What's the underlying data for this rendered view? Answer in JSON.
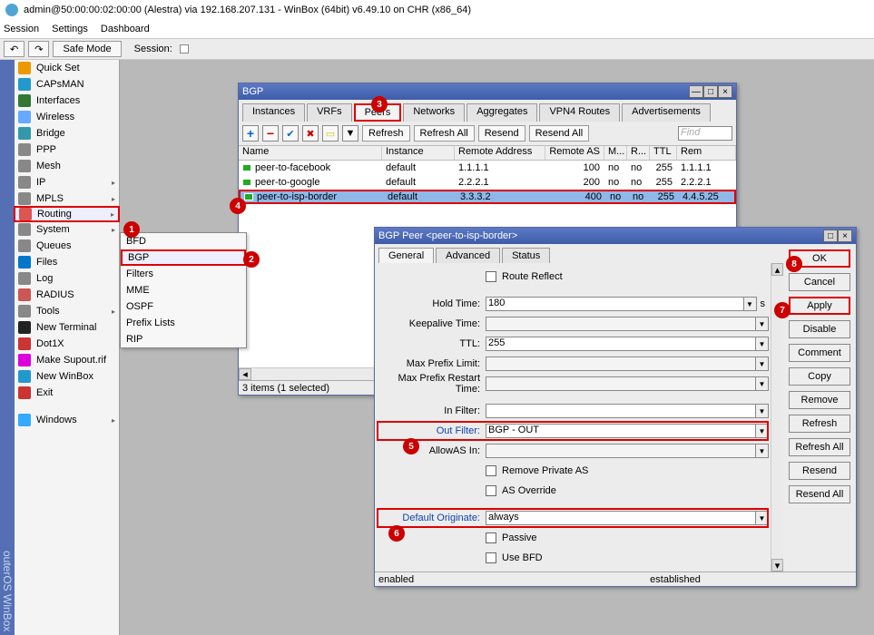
{
  "title": "admin@50:00:00:02:00:00 (Alestra) via 192.168.207.131 - WinBox (64bit) v6.49.10 on CHR (x86_64)",
  "menubar": [
    "Session",
    "Settings",
    "Dashboard"
  ],
  "topstrip": {
    "safe_mode": "Safe Mode",
    "session_label": "Session:"
  },
  "side_label": "outerOS WinBox",
  "sidebar": [
    {
      "label": "Quick Set",
      "tri": false
    },
    {
      "label": "CAPsMAN",
      "tri": false
    },
    {
      "label": "Interfaces",
      "tri": false
    },
    {
      "label": "Wireless",
      "tri": false
    },
    {
      "label": "Bridge",
      "tri": false
    },
    {
      "label": "PPP",
      "tri": false
    },
    {
      "label": "Mesh",
      "tri": false
    },
    {
      "label": "IP",
      "tri": true
    },
    {
      "label": "MPLS",
      "tri": true
    },
    {
      "label": "Routing",
      "tri": true,
      "selected": true
    },
    {
      "label": "System",
      "tri": true
    },
    {
      "label": "Queues",
      "tri": false
    },
    {
      "label": "Files",
      "tri": false
    },
    {
      "label": "Log",
      "tri": false
    },
    {
      "label": "RADIUS",
      "tri": false
    },
    {
      "label": "Tools",
      "tri": true
    },
    {
      "label": "New Terminal",
      "tri": false
    },
    {
      "label": "Dot1X",
      "tri": false
    },
    {
      "label": "Make Supout.rif",
      "tri": false
    },
    {
      "label": "New WinBox",
      "tri": false
    },
    {
      "label": "Exit",
      "tri": false
    }
  ],
  "sidebar_windows": {
    "label": "Windows",
    "tri": true
  },
  "submenu": [
    {
      "label": "BFD"
    },
    {
      "label": "BGP",
      "selected": true
    },
    {
      "label": "Filters"
    },
    {
      "label": "MME"
    },
    {
      "label": "OSPF"
    },
    {
      "label": "Prefix Lists"
    },
    {
      "label": "RIP"
    }
  ],
  "bgp_window": {
    "title": "BGP",
    "tabs": [
      "Instances",
      "VRFs",
      "Peers",
      "Networks",
      "Aggregates",
      "VPN4 Routes",
      "Advertisements"
    ],
    "active_tab": "Peers",
    "buttons": {
      "refresh": "Refresh",
      "refresh_all": "Refresh All",
      "resend": "Resend",
      "resend_all": "Resend All",
      "find": "Find"
    },
    "columns": [
      "Name",
      "Instance",
      "Remote Address",
      "Remote AS",
      "M...",
      "R...",
      "TTL",
      "Rem"
    ],
    "rows": [
      {
        "name": "peer-to-facebook",
        "instance": "default",
        "remote_addr": "1.1.1.1",
        "remote_as": "100",
        "m": "no",
        "r": "no",
        "ttl": "255",
        "rem": "1.1.1.1"
      },
      {
        "name": "peer-to-google",
        "instance": "default",
        "remote_addr": "2.2.2.1",
        "remote_as": "200",
        "m": "no",
        "r": "no",
        "ttl": "255",
        "rem": "2.2.2.1"
      },
      {
        "name": "peer-to-isp-border",
        "instance": "default",
        "remote_addr": "3.3.3.2",
        "remote_as": "400",
        "m": "no",
        "r": "no",
        "ttl": "255",
        "rem": "4.4.5.25",
        "selected": true
      }
    ],
    "status": "3 items (1 selected)"
  },
  "peer_window": {
    "title": "BGP Peer <peer-to-isp-border>",
    "tabs": [
      "General",
      "Advanced",
      "Status"
    ],
    "active_tab": "General",
    "fields": {
      "route_reflect": "Route Reflect",
      "hold_time_lbl": "Hold Time:",
      "hold_time": "180",
      "hold_unit": "s",
      "keepalive_lbl": "Keepalive Time:",
      "keepalive": "",
      "ttl_lbl": "TTL:",
      "ttl": "255",
      "max_prefix_lbl": "Max Prefix Limit:",
      "max_prefix": "",
      "max_restart_lbl": "Max Prefix Restart Time:",
      "max_restart": "",
      "in_filter_lbl": "In Filter:",
      "in_filter": "",
      "out_filter_lbl": "Out Filter:",
      "out_filter": "BGP - OUT",
      "allowas_lbl": "AllowAS In:",
      "allowas": "",
      "remove_private": "Remove Private AS",
      "as_override": "AS Override",
      "default_orig_lbl": "Default Originate:",
      "default_orig": "always",
      "passive": "Passive",
      "use_bfd": "Use BFD"
    },
    "buttons": [
      "OK",
      "Cancel",
      "Apply",
      "Disable",
      "Comment",
      "Copy",
      "Remove",
      "Refresh",
      "Refresh All",
      "Resend",
      "Resend All"
    ],
    "status_left": "enabled",
    "status_right": "established"
  },
  "callouts": {
    "1": "1",
    "2": "2",
    "3": "3",
    "4": "4",
    "5": "5",
    "6": "6",
    "7": "7",
    "8": "8"
  }
}
